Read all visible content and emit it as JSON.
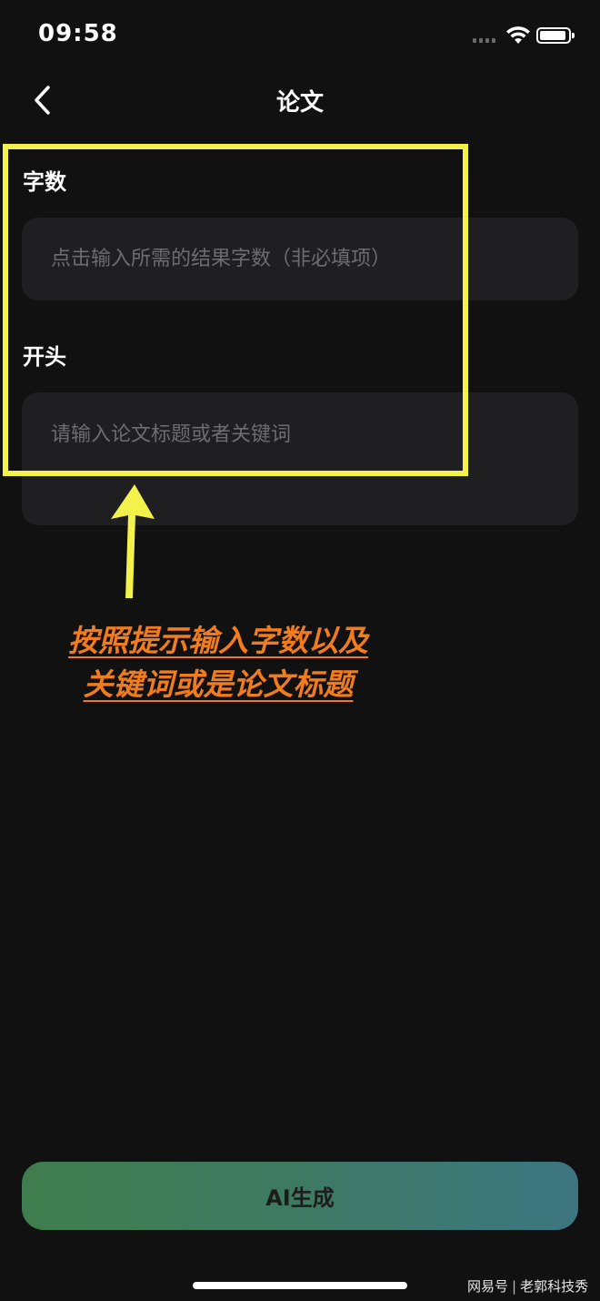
{
  "status_bar": {
    "time": "09:58"
  },
  "nav": {
    "title": "论文",
    "back_icon": "chevron-left-icon"
  },
  "form": {
    "word_count": {
      "label": "字数",
      "placeholder": "点击输入所需的结果字数（非必填项）"
    },
    "opening": {
      "label": "开头",
      "placeholder": "请输入论文标题或者关键词"
    }
  },
  "annotation": {
    "line1": "按照提示输入字数以及",
    "line2": "关键词或是论文标题"
  },
  "generate_button": {
    "label": "AI生成"
  },
  "watermark": {
    "platform": "网易号",
    "author": "老郭科技秀"
  },
  "colors": {
    "background": "#111111",
    "input_bg": "#1f1f21",
    "highlight": "#f2f24a",
    "annotation": "#f07c1d",
    "button_gradient_start": "#3f7d4e",
    "button_gradient_end": "#3d7680"
  }
}
